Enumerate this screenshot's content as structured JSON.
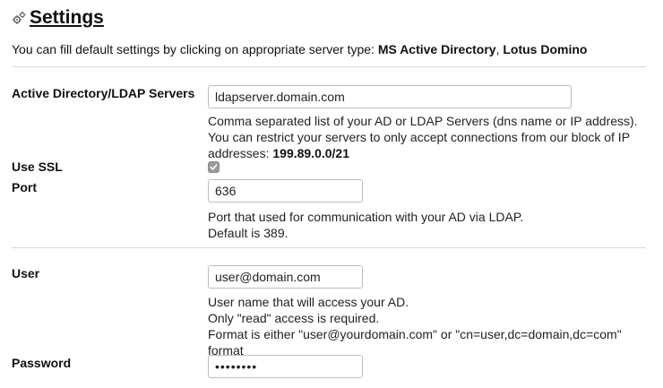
{
  "header": {
    "title": "Settings",
    "icon": "gears-icon"
  },
  "intro": {
    "text": "You can fill default settings by clicking on appropriate server type:",
    "options": [
      "MS Active Directory",
      "Lotus Domino"
    ],
    "separator": ","
  },
  "fields": {
    "servers": {
      "label": "Active Directory/LDAP Servers",
      "value": "ldapserver.domain.com",
      "help_line1": "Comma separated list of your AD or LDAP Servers (dns name or IP address).",
      "help_line2": "You can restrict your servers to only accept connections from our block of IP",
      "help_line3_prefix": "addresses:",
      "help_ip_block": "199.89.0.0/21"
    },
    "ssl": {
      "label": "Use SSL",
      "checked": true
    },
    "port": {
      "label": "Port",
      "value": "636",
      "help_line1": "Port that used for communication with your AD via LDAP.",
      "help_line2": "Default is 389."
    },
    "user": {
      "label": "User",
      "value": "user@domain.com",
      "help_line1": "User name that will access your AD.",
      "help_line2": "Only \"read\" access is required.",
      "help_line3": "Format is either \"user@yourdomain.com\" or \"cn=user,dc=domain,dc=com\"",
      "help_line4": "format"
    },
    "password": {
      "label": "Password",
      "value": "••••••••"
    }
  }
}
